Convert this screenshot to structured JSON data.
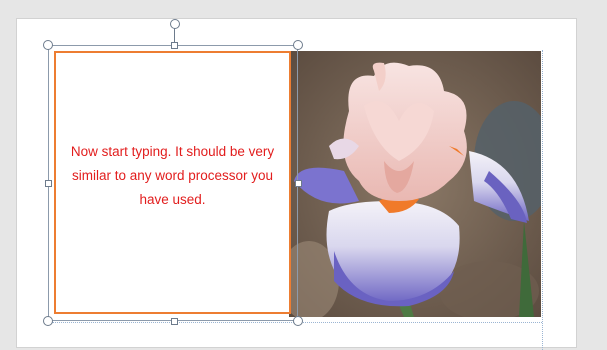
{
  "text_box": {
    "text": "Now start typing.  It should be very similar to any word processor you have  used."
  },
  "photo": {
    "subject": "iris flower photo"
  },
  "handles": {
    "rotate": "rotation-handle",
    "corners": [
      "top-left",
      "top-right",
      "bottom-left",
      "bottom-right"
    ],
    "sides": [
      "top",
      "bottom",
      "left",
      "right"
    ]
  },
  "colors": {
    "text": "#e21d1d",
    "text_box_border": "#ed7d31",
    "selection_frame": "#8c9aab",
    "page_background": "#ffffff",
    "workspace_background": "#e6e6e6"
  }
}
